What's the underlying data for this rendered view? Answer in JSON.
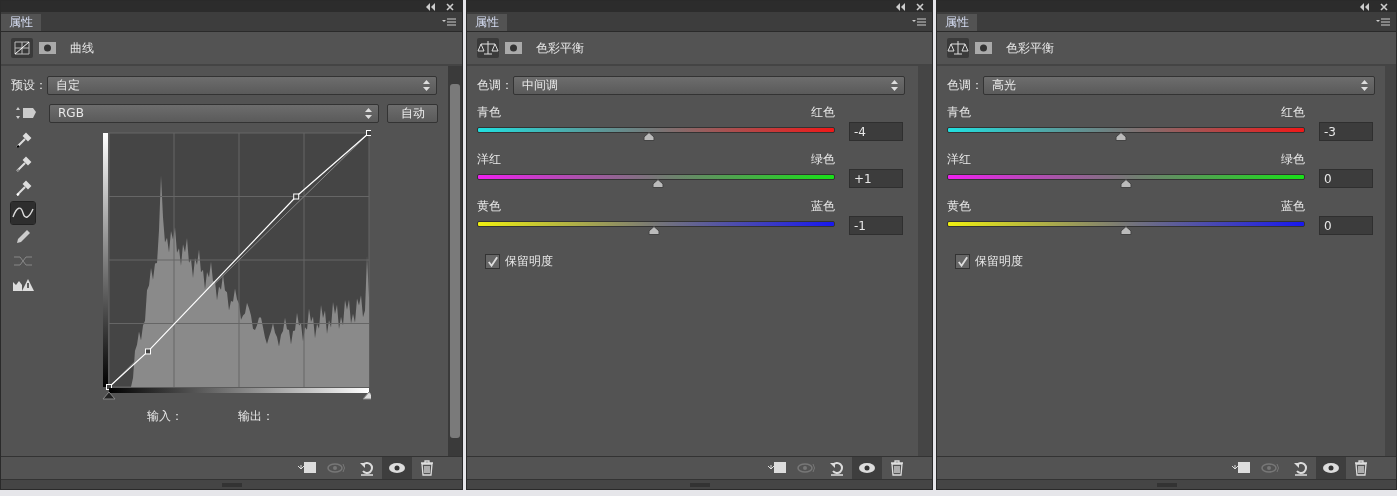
{
  "panels": [
    {
      "kind": "curves",
      "tab": {
        "label": "属性",
        "selected": true
      },
      "title": "曲线",
      "preset_label": "预设：",
      "preset": "自定",
      "channel": "RGB",
      "auto_button": "自动",
      "tools": [
        {
          "kind": "dropper-black",
          "selected": false
        },
        {
          "kind": "dropper-gray",
          "selected": false
        },
        {
          "kind": "dropper-white",
          "selected": false
        },
        {
          "kind": "curve",
          "selected": true
        },
        {
          "kind": "pencil",
          "selected": false
        },
        {
          "kind": "smooth",
          "selected": false
        },
        {
          "kind": "warning",
          "selected": false
        }
      ],
      "shadow_point": {
        "level": 0
      },
      "highlight_point": {
        "level": 1
      },
      "input_label": "输入：",
      "output_label": "输出：",
      "footer": [
        {
          "kind": "clip",
          "disabled": false,
          "selected": false
        },
        {
          "kind": "previous",
          "disabled": true,
          "selected": false
        },
        {
          "kind": "reset",
          "disabled": false,
          "selected": false
        },
        {
          "kind": "eye",
          "disabled": false,
          "selected": true
        },
        {
          "kind": "trash",
          "disabled": false,
          "selected": false
        }
      ]
    },
    {
      "kind": "color_balance",
      "tab": {
        "label": "属性",
        "selected": true
      },
      "title": "色彩平衡",
      "tone_label": "色调：",
      "tone": "中间调",
      "sliders": [
        {
          "kind": "cyan_red",
          "left": "青色",
          "right": "红色",
          "level": 0.48,
          "value": "-4"
        },
        {
          "kind": "magenta_green",
          "left": "洋红",
          "right": "绿色",
          "level": 0.505,
          "value": "+1"
        },
        {
          "kind": "yellow_blue",
          "left": "黄色",
          "right": "蓝色",
          "level": 0.495,
          "value": "-1"
        }
      ],
      "preserve": {
        "label": "保留明度",
        "checked": true
      },
      "footer": [
        {
          "kind": "clip",
          "disabled": false,
          "selected": false
        },
        {
          "kind": "previous",
          "disabled": true,
          "selected": false
        },
        {
          "kind": "reset",
          "disabled": false,
          "selected": false
        },
        {
          "kind": "eye",
          "disabled": false,
          "selected": true
        },
        {
          "kind": "trash",
          "disabled": false,
          "selected": false
        }
      ]
    },
    {
      "kind": "color_balance",
      "tab": {
        "label": "属性",
        "selected": true
      },
      "title": "色彩平衡",
      "tone_label": "色调：",
      "tone": "高光",
      "sliders": [
        {
          "kind": "cyan_red",
          "left": "青色",
          "right": "红色",
          "level": 0.485,
          "value": "-3"
        },
        {
          "kind": "magenta_green",
          "left": "洋红",
          "right": "绿色",
          "level": 0.5,
          "value": "0"
        },
        {
          "kind": "yellow_blue",
          "left": "黄色",
          "right": "蓝色",
          "level": 0.5,
          "value": "0"
        }
      ],
      "preserve": {
        "label": "保留明度",
        "checked": true
      },
      "footer": [
        {
          "kind": "clip",
          "disabled": false,
          "selected": false
        },
        {
          "kind": "previous",
          "disabled": true,
          "selected": false
        },
        {
          "kind": "reset",
          "disabled": false,
          "selected": false
        },
        {
          "kind": "eye",
          "disabled": false,
          "selected": true
        },
        {
          "kind": "trash",
          "disabled": false,
          "selected": false
        }
      ]
    }
  ]
}
